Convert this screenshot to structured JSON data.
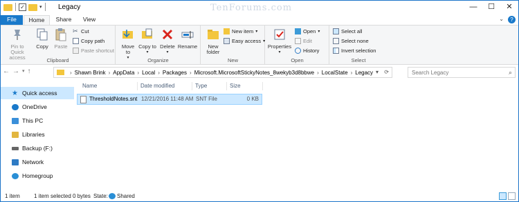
{
  "window": {
    "title": "Legacy",
    "watermark": "TenForums.com"
  },
  "titlebar": {
    "minimize": "—",
    "maximize": "☐",
    "close": "✕",
    "qat_down": "▾"
  },
  "tabs": [
    {
      "label": "File"
    },
    {
      "label": "Home"
    },
    {
      "label": "Share"
    },
    {
      "label": "View"
    }
  ],
  "ribbon": {
    "clipboard": {
      "label": "Clipboard",
      "pin": "Pin to Quick access",
      "copy": "Copy",
      "paste": "Paste",
      "cut": "Cut",
      "copy_path": "Copy path",
      "paste_shortcut": "Paste shortcut"
    },
    "organize": {
      "label": "Organize",
      "move_to": "Move to",
      "copy_to": "Copy to",
      "delete": "Delete",
      "rename": "Rename"
    },
    "new": {
      "label": "New",
      "new_folder": "New folder",
      "new_item": "New item",
      "easy_access": "Easy access"
    },
    "open": {
      "label": "Open",
      "properties": "Properties",
      "open": "Open",
      "edit": "Edit",
      "history": "History"
    },
    "select": {
      "label": "Select",
      "select_all": "Select all",
      "select_none": "Select none",
      "invert": "Invert selection"
    }
  },
  "address": {
    "crumbs": [
      "Shawn Brink",
      "AppData",
      "Local",
      "Packages",
      "Microsoft.MicrosoftStickyNotes_8wekyb3d8bbwe",
      "LocalState",
      "Legacy"
    ],
    "search_placeholder": "Search Legacy"
  },
  "navpane": {
    "items": [
      {
        "label": "Quick access",
        "icon": "star-icon",
        "color": "#1979ca"
      },
      {
        "label": "OneDrive",
        "icon": "cloud-icon",
        "color": "#1979ca"
      },
      {
        "label": "This PC",
        "icon": "monitor-icon",
        "color": "#3a8fd9"
      },
      {
        "label": "Libraries",
        "icon": "library-icon",
        "color": "#e2b640"
      },
      {
        "label": "Backup (F:)",
        "icon": "drive-icon",
        "color": "#666666"
      },
      {
        "label": "Network",
        "icon": "network-icon",
        "color": "#2e7bc4"
      },
      {
        "label": "Homegroup",
        "icon": "homegroup-icon",
        "color": "#2a8fd6"
      }
    ]
  },
  "filelist": {
    "columns": [
      "Name",
      "Date modified",
      "Type",
      "Size"
    ],
    "rows": [
      {
        "name": "ThresholdNotes.snt",
        "date": "12/21/2016 11:48 AM",
        "type": "SNT File",
        "size": "0 KB"
      }
    ]
  },
  "status": {
    "count": "1 item",
    "selected": "1 item selected  0 bytes",
    "state_label": "State:",
    "state_value": "Shared"
  },
  "colors": {
    "accent": "#1979ca",
    "selection": "#cce8ff",
    "folder": "#f3c63d",
    "delete_red": "#d9241c"
  }
}
